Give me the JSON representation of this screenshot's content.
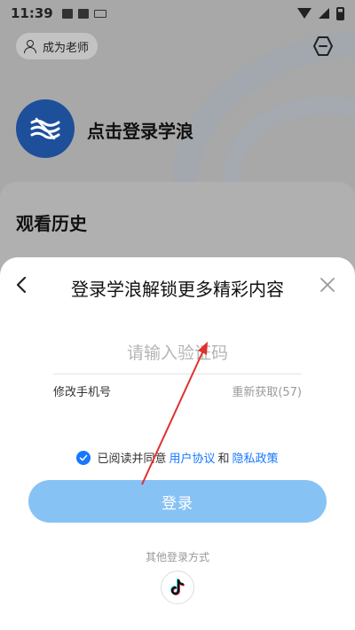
{
  "status_bar": {
    "time": "11:39"
  },
  "background": {
    "teacher_chip_label": "成为老师",
    "login_prompt": "点击登录学浪",
    "history_title": "观看历史"
  },
  "sheet": {
    "title": "登录学浪解锁更多精彩内容",
    "code_input": {
      "placeholder": "请输入验证码",
      "value": ""
    },
    "change_phone": "修改手机号",
    "resend": "重新获取(57)",
    "agreement": {
      "prefix": "已阅读并同意",
      "user_agreement": "用户协议",
      "and": "和",
      "privacy_policy": "隐私政策",
      "checked": true
    },
    "login_button": "登录",
    "other_login": "其他登录方式"
  },
  "colors": {
    "accent": "#1677ff",
    "login_button": "#87c2f5",
    "annotation_arrow": "#e0302f",
    "logo": "#1e4f9a"
  },
  "icons": [
    "person-icon",
    "hexagon-menu-icon",
    "back-arrow-icon",
    "close-icon",
    "checkbox-icon",
    "tiktok-icon"
  ]
}
